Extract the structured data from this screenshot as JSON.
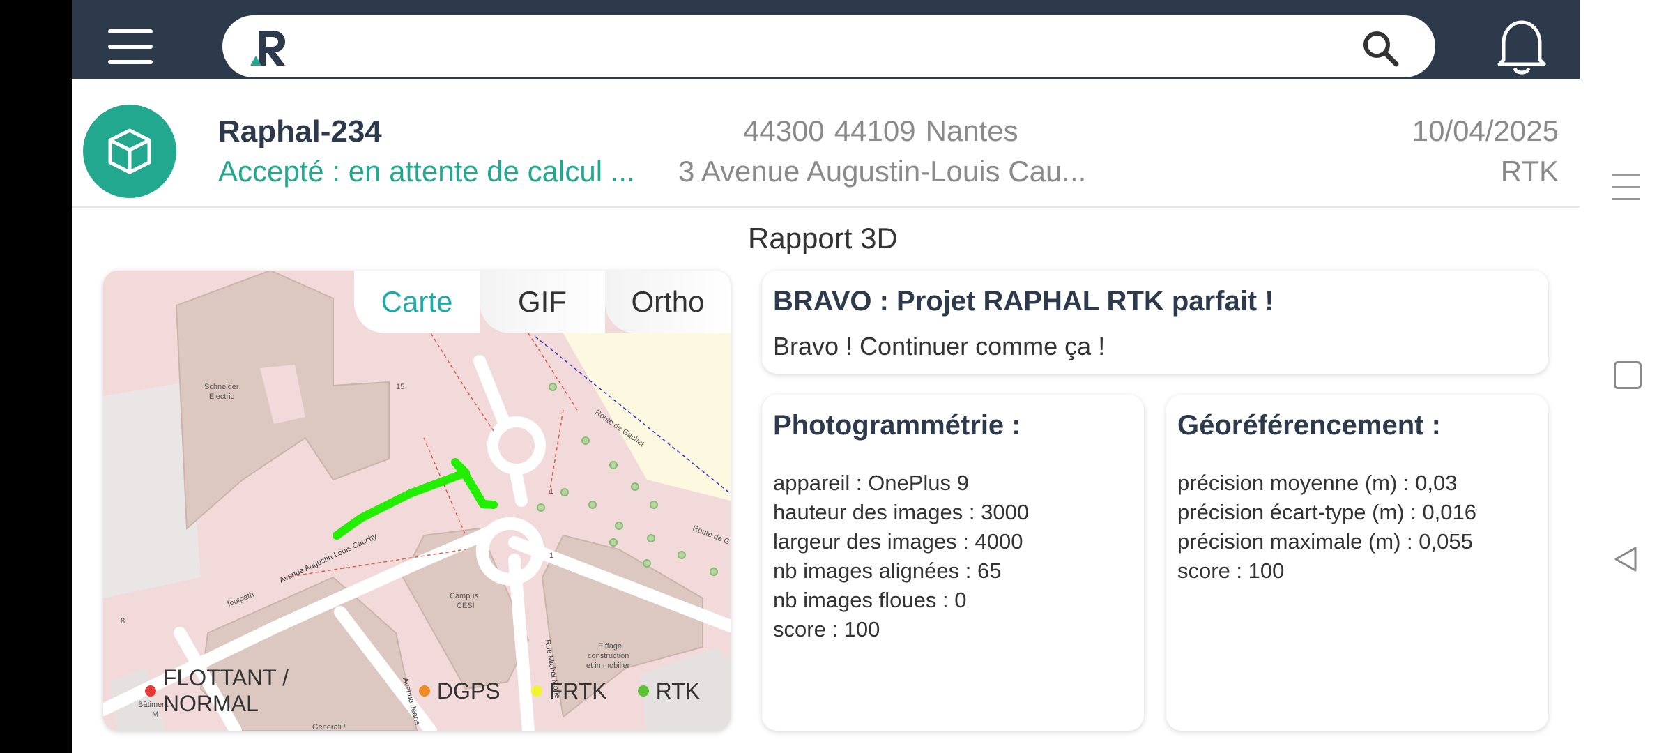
{
  "search": {
    "placeholder": ""
  },
  "project": {
    "name": "Raphal-234",
    "status": "Accepté : en attente de calcul ...",
    "postal_code": "44300",
    "insee_code": "44109",
    "city": "Nantes",
    "address": "3 Avenue Augustin-Louis Cau...",
    "date": "10/04/2025",
    "mode": "RTK"
  },
  "report": {
    "title": "Rapport 3D"
  },
  "map": {
    "tabs": [
      {
        "label": "Carte",
        "active": true
      },
      {
        "label": "GIF",
        "active": false
      },
      {
        "label": "Ortho",
        "active": false
      }
    ],
    "labels": {
      "schneider": "Schneider",
      "electric": "Electric",
      "campus": "Campus",
      "cesi": "CESI",
      "eiffage1": "Eiffage",
      "eiffage2": "construction",
      "eiffage3": "et immobilier",
      "route_gachet": "Route de Gachet",
      "route_right": "Route de G",
      "avenue": "Avenue Augustin-Louis Cauchy",
      "footpath": "footpath",
      "rue_michel": "Rue Michel Marie",
      "avenue2": "Avenue Jeane",
      "batiment": "Bâtiment",
      "batiment2": "M",
      "generali": "Generali /",
      "n15": "15",
      "n1a": "1",
      "n1b": "1",
      "n8": "8"
    },
    "legend": [
      {
        "label": "FLOTTANT / NORMAL",
        "color": "#e53935"
      },
      {
        "label": "DGPS",
        "color": "#f08a24"
      },
      {
        "label": "FRTK",
        "color": "#f2f230"
      },
      {
        "label": "RTK",
        "color": "#5bc236"
      }
    ],
    "track_color": "#22ee00"
  },
  "bravo": {
    "title": "BRAVO : Projet RAPHAL RTK parfait !",
    "message": "Bravo ! Continuer comme ça !"
  },
  "photogrammetry": {
    "title": "Photogrammétrie :",
    "lines": [
      "appareil : OnePlus 9",
      "hauteur des images : 3000",
      "largeur des images : 4000",
      "nb images alignées : 65",
      "nb images floues : 0",
      "score : 100"
    ]
  },
  "georef": {
    "title": "Géoréférencement :",
    "lines": [
      "précision moyenne (m) : 0,03",
      "précision écart-type (m) : 0,016",
      "précision maximale (m) : 0,055",
      "score : 100"
    ]
  },
  "colors": {
    "topbar": "#2d3a4b",
    "accent": "#21a88f",
    "tab_active": "#21a8a8"
  }
}
